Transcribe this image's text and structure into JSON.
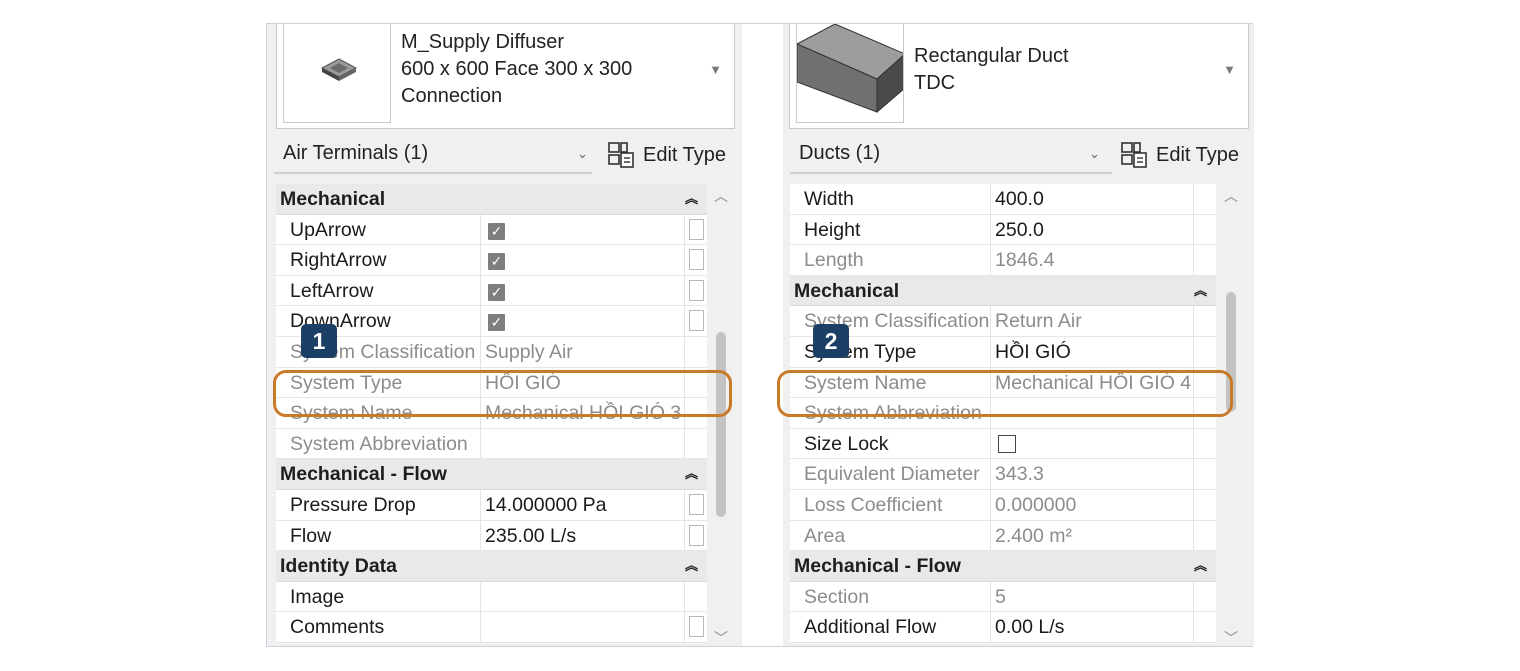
{
  "left": {
    "type_selector": {
      "lines": [
        "M_Supply Diffuser",
        "600 x 600 Face 300 x 300",
        "Connection"
      ],
      "arrow": "▼"
    },
    "instance_filter": "Air Terminals (1)",
    "edit_type_label": "Edit Type",
    "badge": "1",
    "rows": [
      {
        "kind": "group",
        "name": "Mechanical"
      },
      {
        "kind": "check",
        "name": "UpArrow",
        "checked": true
      },
      {
        "kind": "check",
        "name": "RightArrow",
        "checked": true
      },
      {
        "kind": "check",
        "name": "LeftArrow",
        "checked": true
      },
      {
        "kind": "check",
        "name": "DownArrow",
        "checked": true
      },
      {
        "kind": "prop",
        "name": "System Classification",
        "value": "Supply Air",
        "ro": true
      },
      {
        "kind": "prop",
        "name": "System Type",
        "value": "HỒI GIÓ",
        "ro": true,
        "strike": true
      },
      {
        "kind": "prop",
        "name": "System Name",
        "value": "Mechanical HỒI GIÓ 3",
        "ro": true,
        "strike": true
      },
      {
        "kind": "prop",
        "name": "System Abbreviation",
        "value": "",
        "ro": true
      },
      {
        "kind": "group",
        "name": "Mechanical - Flow"
      },
      {
        "kind": "prop",
        "name": "Pressure Drop",
        "value": "14.000000 Pa",
        "aux": true
      },
      {
        "kind": "prop",
        "name": "Flow",
        "value": "235.00 L/s",
        "aux": true
      },
      {
        "kind": "group",
        "name": "Identity Data"
      },
      {
        "kind": "prop",
        "name": "Image",
        "value": ""
      },
      {
        "kind": "prop",
        "name": "Comments",
        "value": "",
        "aux": true
      }
    ]
  },
  "right": {
    "type_selector": {
      "lines": [
        "Rectangular Duct",
        "TDC"
      ],
      "arrow": "▼"
    },
    "instance_filter": "Ducts (1)",
    "edit_type_label": "Edit Type",
    "badge": "2",
    "rows": [
      {
        "kind": "prop",
        "name": "Width",
        "value": "400.0"
      },
      {
        "kind": "prop",
        "name": "Height",
        "value": "250.0"
      },
      {
        "kind": "prop",
        "name": "Length",
        "value": "1846.4",
        "ro": true
      },
      {
        "kind": "group",
        "name": "Mechanical"
      },
      {
        "kind": "prop",
        "name": "System Classification",
        "value": "Return Air",
        "ro": true
      },
      {
        "kind": "prop",
        "name": "System Type",
        "value": "HỒI GIÓ"
      },
      {
        "kind": "prop",
        "name": "System Name",
        "value": "Mechanical HỒI GIÓ 4",
        "ro": true,
        "strike": true
      },
      {
        "kind": "prop",
        "name": "System Abbreviation",
        "value": "",
        "ro": true,
        "strike": true
      },
      {
        "kind": "check",
        "name": "Size Lock",
        "checked": false
      },
      {
        "kind": "prop",
        "name": "Equivalent Diameter",
        "value": "343.3",
        "ro": true
      },
      {
        "kind": "prop",
        "name": "Loss Coefficient",
        "value": "0.000000",
        "ro": true
      },
      {
        "kind": "prop",
        "name": "Area",
        "value": "2.400 m²",
        "ro": true
      },
      {
        "kind": "group",
        "name": "Mechanical - Flow"
      },
      {
        "kind": "prop",
        "name": "Section",
        "value": "5",
        "ro": true
      },
      {
        "kind": "prop",
        "name": "Additional Flow",
        "value": "0.00 L/s"
      }
    ]
  },
  "icons": {
    "collapse": "chevrons-up-icon",
    "dropdown": "chevron-down-icon",
    "edit_type": "edit-type-icon",
    "scroll_up": "scroll-up-icon",
    "scroll_down": "scroll-down-icon"
  },
  "colors": {
    "highlight": "#c97a28",
    "badge": "#1c3f66"
  }
}
